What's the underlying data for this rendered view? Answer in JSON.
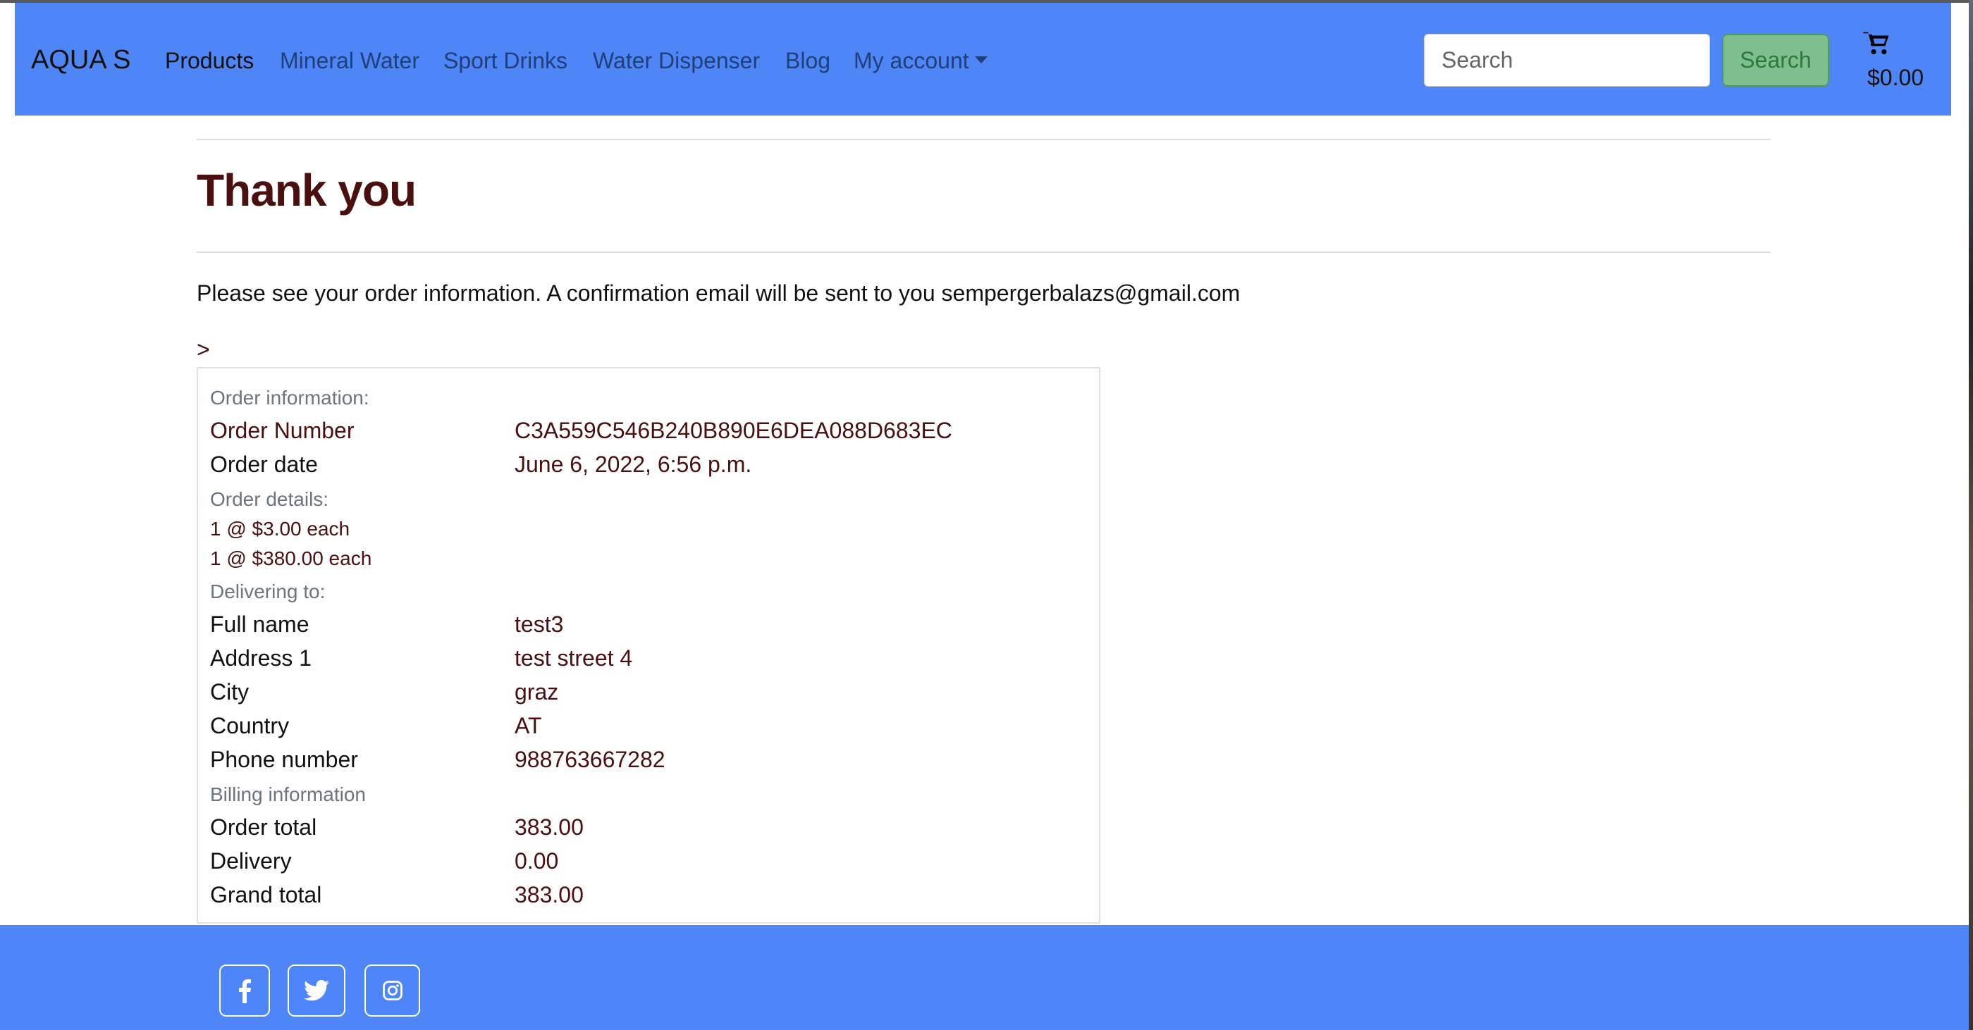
{
  "navbar": {
    "brand": "AQUA S",
    "links": [
      {
        "label": "Products"
      },
      {
        "label": "Mineral Water"
      },
      {
        "label": "Sport Drinks"
      },
      {
        "label": "Water Dispenser"
      },
      {
        "label": "Blog"
      },
      {
        "label": "My account"
      }
    ],
    "search_placeholder": "Search",
    "search_button": "Search",
    "cart_icon": "shopping-cart-icon",
    "cart_total": "$0.00"
  },
  "main": {
    "title": "Thank you",
    "intro": "Please see your order information. A confirmation email will be sent to you sempergerbalazs@gmail.com",
    "stray_text": ">",
    "order_info_heading": "Order information:",
    "order_number_label": "Order Number",
    "order_number": "C3A559C546B240B890E6DEA088D683EC",
    "order_date_label": "Order date",
    "order_date": "June 6, 2022, 6:56 p.m.",
    "order_details_heading": "Order details:",
    "items": [
      "1 @ $3.00 each",
      "1 @ $380.00 each"
    ],
    "delivering_heading": "Delivering to:",
    "delivery": [
      {
        "label": "Full name",
        "value": "test3"
      },
      {
        "label": "Address 1",
        "value": "test street 4"
      },
      {
        "label": "City",
        "value": "graz"
      },
      {
        "label": "Country",
        "value": "AT"
      },
      {
        "label": "Phone number",
        "value": "988763667282"
      }
    ],
    "billing_heading": "Billing information",
    "billing": [
      {
        "label": "Order total",
        "value": "383.00"
      },
      {
        "label": "Delivery",
        "value": "0.00"
      },
      {
        "label": "Grand total",
        "value": "383.00"
      }
    ]
  },
  "footer": {
    "social_icons": [
      "facebook-icon",
      "twitter-icon",
      "instagram-icon"
    ]
  },
  "colors": {
    "navbar_bg": "#4f86f7",
    "heading_text": "#4a1010",
    "search_button_bg": "#7fbf8f"
  }
}
